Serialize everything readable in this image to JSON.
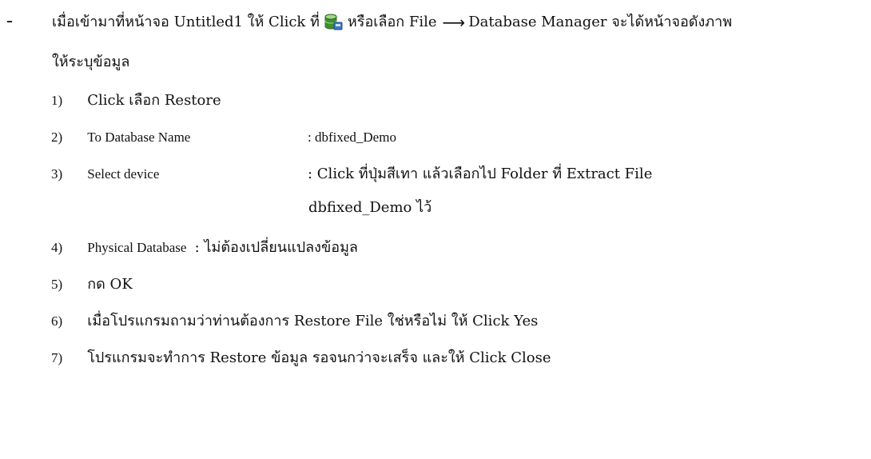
{
  "intro": {
    "dash": "-",
    "part1": "เมื่อเข้ามาที่หน้าจอ Untitled1 ให้ Click ที่",
    "icon": "database-icon",
    "part2": "หรือเลือก File",
    "arrow": "⟶",
    "part3": "Database Manager จะได้หน้าจอดังภาพ",
    "line2": "ให้ระบุข้อมูล"
  },
  "steps": [
    {
      "num": "1)",
      "label": "Click เลือก Restore",
      "value": ""
    },
    {
      "num": "2)",
      "label": "To Database Name",
      "value": ": dbfixed_Demo"
    },
    {
      "num": "3)",
      "label": "Select device",
      "value": ": Click ที่ปุ่มสีเทา แล้วเลือกไป Folder ที่ Extract File",
      "continuation": "dbfixed_Demo ไว้"
    },
    {
      "num": "4)",
      "label": "Physical Database",
      "value": ": ไม่ต้องเปลี่ยนแปลงข้อมูล"
    },
    {
      "num": "5)",
      "label": "กด OK",
      "value": ""
    },
    {
      "num": "6)",
      "label": "เมื่อโปรแกรมถามว่าท่านต้องการ Restore File ใช่หรือไม่ ให้ Click Yes",
      "value": ""
    },
    {
      "num": "7)",
      "label": "โปรแกรมจะทำการ Restore ข้อมูล รอจนกว่าจะเสร็จ และให้ Click Close",
      "value": ""
    }
  ],
  "colors": {
    "icon_green": "#3f8f2e",
    "icon_top": "#7fc56a",
    "icon_blue": "#3b78c9"
  }
}
